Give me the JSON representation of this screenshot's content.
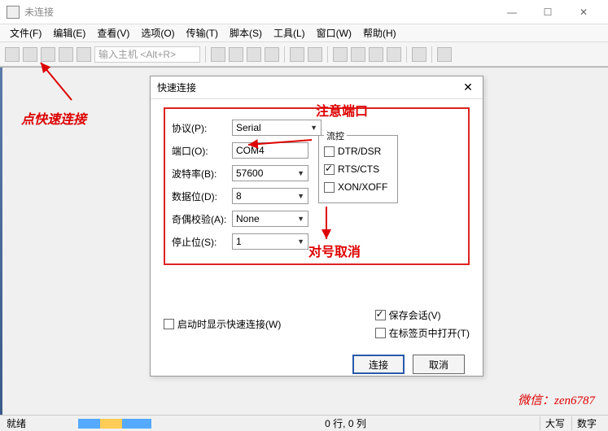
{
  "window": {
    "title": "未连接"
  },
  "win_buttons": {
    "min": "—",
    "max": "☐",
    "close": "✕"
  },
  "menus": [
    "文件(F)",
    "编辑(E)",
    "查看(V)",
    "选项(O)",
    "传输(T)",
    "脚本(S)",
    "工具(L)",
    "窗口(W)",
    "帮助(H)"
  ],
  "toolbar": {
    "host_placeholder": "输入主机 <Alt+R>"
  },
  "status": {
    "ready": "就绪",
    "position": "0 行, 0 列",
    "caps": "大写",
    "num": "数字"
  },
  "dialog": {
    "title": "快速连接",
    "labels": {
      "protocol": "协议(P):",
      "port": "端口(O):",
      "baud": "波特率(B):",
      "databits": "数据位(D):",
      "parity": "奇偶校验(A):",
      "stopbits": "停止位(S):"
    },
    "values": {
      "protocol": "Serial",
      "port": "COM4",
      "baud": "57600",
      "databits": "8",
      "parity": "None",
      "stopbits": "1"
    },
    "flow": {
      "legend": "流控",
      "dtr": "DTR/DSR",
      "rts": "RTS/CTS",
      "xon": "XON/XOFF"
    },
    "startup_show": "启动时显示快速连接(W)",
    "save_session": "保存会话(V)",
    "open_in_tab": "在标签页中打开(T)",
    "connect": "连接",
    "cancel": "取消"
  },
  "annotations": {
    "click_quick": "点快速连接",
    "note_port": "注意端口",
    "uncheck": "对号取消"
  },
  "watermark": "微信：zen6787"
}
